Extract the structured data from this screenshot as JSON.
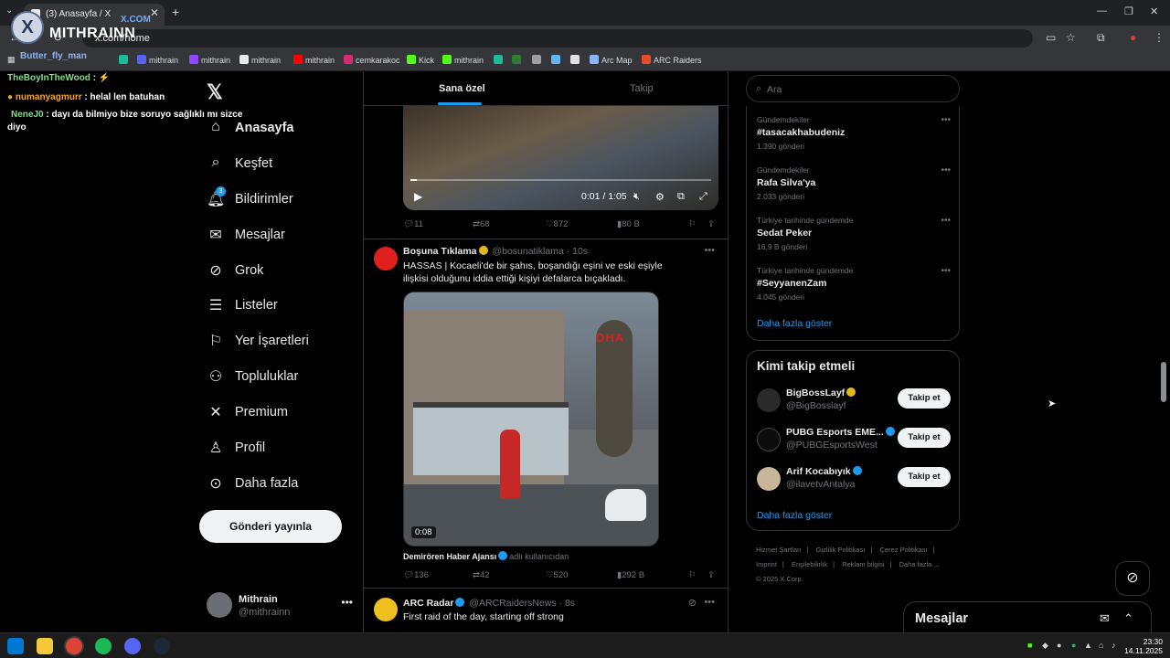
{
  "browser": {
    "tab_title": "(3) Anasayfa / X",
    "url": "x.com/home",
    "bookmarks": [
      {
        "label": "mithrain",
        "color": "#5865f2"
      },
      {
        "label": "mithrain",
        "color": "#9146ff"
      },
      {
        "label": "mithrain",
        "color": "#e7e9ea"
      },
      {
        "label": "mithrain",
        "color": "#ff0000"
      },
      {
        "label": "cemkarakoc",
        "color": "#d62976"
      },
      {
        "label": "Kick",
        "color": "#53fc18"
      },
      {
        "label": "mithrain",
        "color": "#53fc18"
      },
      {
        "label": "Arc Map",
        "color": "#8ab4f8"
      },
      {
        "label": "ARC Raiders",
        "color": "#e34c26"
      }
    ]
  },
  "overlay": {
    "logo_text": "MITHRAINN",
    "logo_sub": "X.COM",
    "chat": [
      {
        "user": "Butter_fly_man",
        "msg": ""
      },
      {
        "user": "TheBoyInTheWood",
        "msg": ":"
      },
      {
        "user": "numanyagmurr",
        "msg": ": helal len batuhan"
      },
      {
        "user": "NeneJ0",
        "msg": ": dayı da bilmiyo bize soruyo sağlıklı mı sizce"
      },
      {
        "user": "",
        "msg": "diyo"
      }
    ]
  },
  "nav": {
    "items": [
      {
        "label": "Anasayfa",
        "icon": "home-icon"
      },
      {
        "label": "Keşfet",
        "icon": "search-icon"
      },
      {
        "label": "Bildirimler",
        "icon": "bell-icon",
        "badge": "3"
      },
      {
        "label": "Mesajlar",
        "icon": "mail-icon"
      },
      {
        "label": "Grok",
        "icon": "grok-icon"
      },
      {
        "label": "Listeler",
        "icon": "list-icon"
      },
      {
        "label": "Yer İşaretleri",
        "icon": "bookmark-icon"
      },
      {
        "label": "Topluluklar",
        "icon": "communities-icon"
      },
      {
        "label": "Premium",
        "icon": "x-logo-icon"
      },
      {
        "label": "Profil",
        "icon": "profile-icon"
      },
      {
        "label": "Daha fazla",
        "icon": "more-circle-icon"
      }
    ],
    "post_button": "Gönderi yayınla",
    "account": {
      "name": "Mithrain",
      "handle": "@mithrainn"
    }
  },
  "feed": {
    "tabs": [
      "Sana özel",
      "Takip"
    ],
    "video1": {
      "time": "0:01 / 1:05",
      "progress": 0.02
    },
    "tweet1_stats": {
      "replies": "11",
      "reposts": "68",
      "likes": "872",
      "views": "80 B"
    },
    "tweet2": {
      "name": "Boşuna Tıklama",
      "handle": "@bosunatiklama",
      "time": "10s",
      "text": "HASSAS | Kocaeli'de bir şahıs, boşandığı eşini ve eski eşiyle ilişkisi olduğunu iddia ettiği kişiyi defalarca bıçakladı.",
      "media_overlay": "DHA",
      "duration": "0:08",
      "credit_name": "Demirören Haber Ajansı",
      "credit_suffix": "adlı kullanıcıdan",
      "stats": {
        "replies": "136",
        "reposts": "42",
        "likes": "520",
        "views": "292 B"
      }
    },
    "tweet3": {
      "name": "ARC Radar",
      "handle": "@ARCRaidersNews",
      "time": "8s",
      "text": "First raid of the day, starting off strong"
    }
  },
  "sidebar": {
    "search_placeholder": "Ara",
    "trends": [
      {
        "context": "Gündemdekiler",
        "name": "#tasacakhabudeniz",
        "posts": "1.390 gönderi"
      },
      {
        "context": "Gündemdekiler",
        "name": "Rafa Silva'ya",
        "posts": "2.033 gönderi"
      },
      {
        "context": "Türkiye tarihinde gündemde",
        "name": "Sedat Peker",
        "posts": "16,9 B gönderi"
      },
      {
        "context": "Türkiye tarihinde gündemde",
        "name": "#SeyyanenZam",
        "posts": "4.045 gönderi"
      }
    ],
    "trends_more": "Daha fazla göster",
    "who_to_follow_title": "Kimi takip etmeli",
    "who_to_follow": [
      {
        "name": "BigBossLayf",
        "handle": "@BigBosslayf",
        "avatar_color": "#2a2a2a",
        "badge_color": "#e2b719"
      },
      {
        "name": "PUBG Esports EME...",
        "handle": "@PUBGEsportsWest",
        "avatar_color": "#0c0c0c",
        "badge_color": "#1d9bf0"
      },
      {
        "name": "Arif Kocabıyık",
        "handle": "@ilavetvAntalya",
        "avatar_color": "#c9b59a",
        "badge_color": "#1d9bf0"
      }
    ],
    "follow_label": "Takip et",
    "wtf_more": "Daha fazla göster",
    "footer": [
      "Hizmet Şartları",
      "|",
      "Gizlilik Politikası",
      "|",
      "Çerez Politikası",
      "|",
      "Imprint",
      "|",
      "Erişilebilirlik",
      "|",
      "Reklam bilgisi",
      "|",
      "Daha fazla ...",
      "© 2025 X Corp."
    ]
  },
  "dm_drawer": {
    "title": "Mesajlar"
  },
  "taskbar": {
    "time": "23:30",
    "date": "14.11.2025"
  }
}
